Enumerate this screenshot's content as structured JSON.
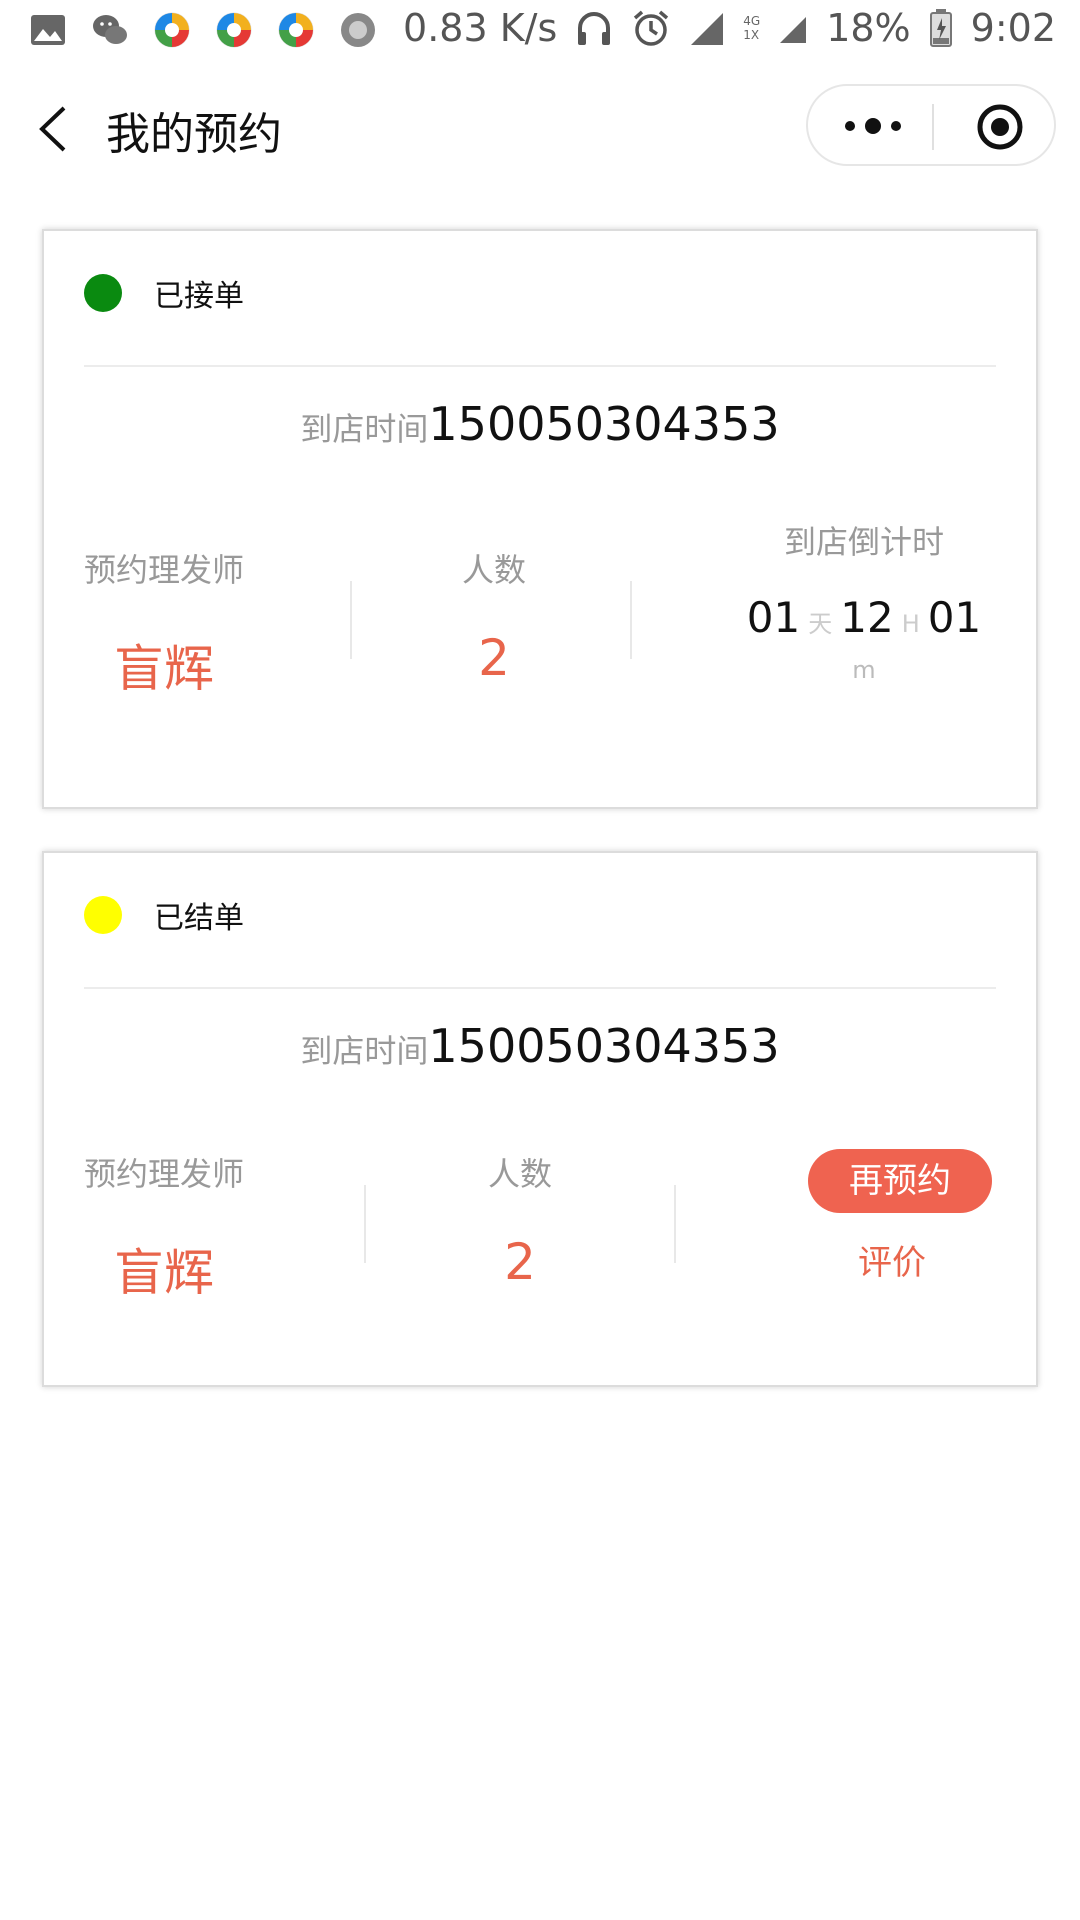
{
  "status_bar": {
    "net_speed": "0.83 K/s",
    "battery": "18%",
    "time": "9:02",
    "net_type_top": "4G",
    "net_type_bottom": "1X"
  },
  "nav": {
    "title": "我的预约"
  },
  "orders": [
    {
      "status": "已接单",
      "status_color": "#0a8a10",
      "arrival_label": "到店时间",
      "arrival_value": "150050304353",
      "stylist_label": "预约理发师",
      "stylist_name": "盲辉",
      "people_label": "人数",
      "people_count": "2",
      "countdown_label": "到店倒计时",
      "countdown": {
        "days": "01",
        "day_unit": "天",
        "hours": "12",
        "hour_unit": "H",
        "minutes": "01",
        "minute_unit": "m"
      }
    },
    {
      "status": "已结单",
      "status_color": "#ffff00",
      "arrival_label": "到店时间",
      "arrival_value": "150050304353",
      "stylist_label": "预约理发师",
      "stylist_name": "盲辉",
      "people_label": "人数",
      "people_count": "2",
      "rebook_label": "再预约",
      "review_label": "评价"
    }
  ],
  "colors": {
    "accent": "#e8654b",
    "button": "#ef6350"
  }
}
